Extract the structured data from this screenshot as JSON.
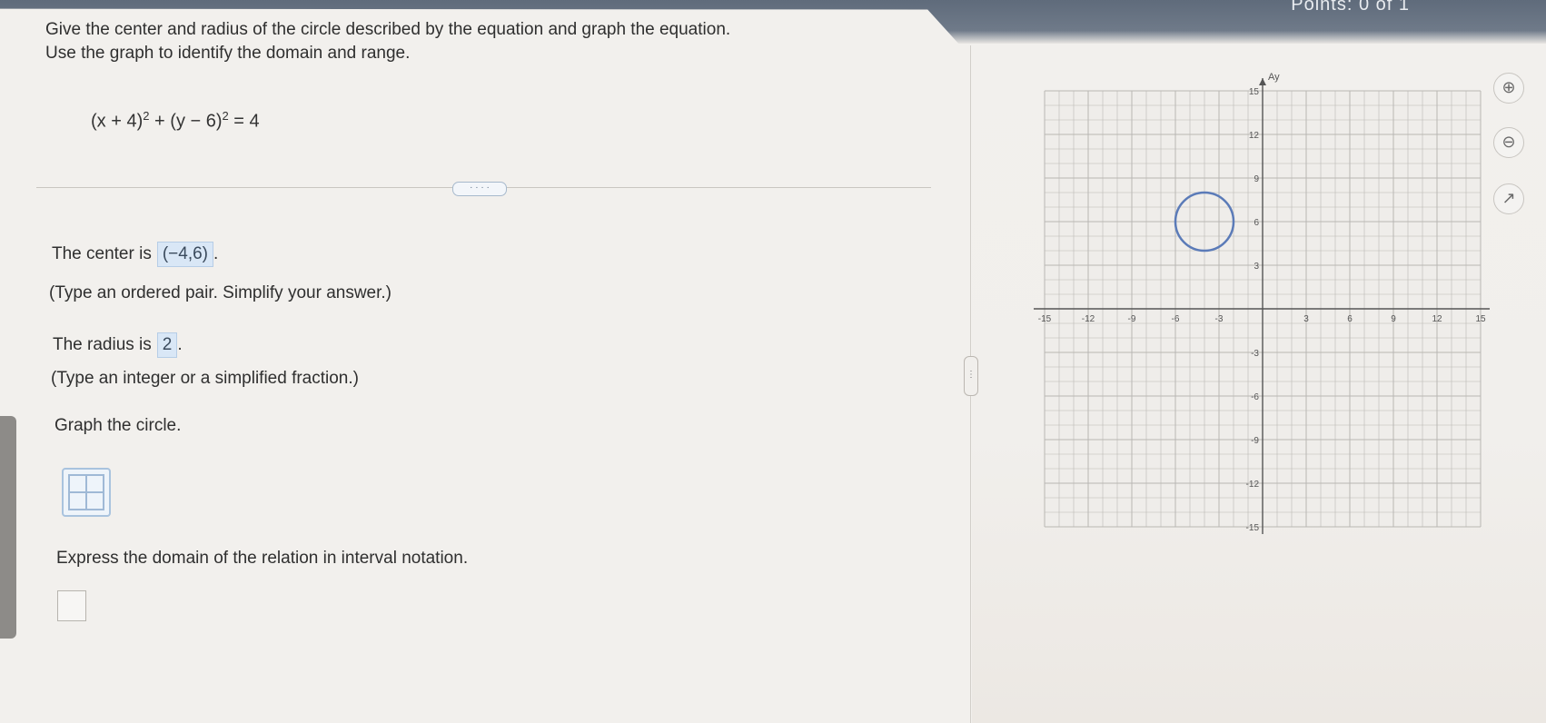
{
  "header": {
    "points": "Points: 0 of 1"
  },
  "question": {
    "line1": "Give the center and radius of the circle described by the equation and graph the equation.",
    "line2": "Use the graph to identify the domain and range.",
    "eq_part1": "(x + 4)",
    "eq_exp1": "2",
    "eq_part2": " + (y − 6)",
    "eq_exp2": "2",
    "eq_part3": " = 4"
  },
  "more_button": "· · · ·",
  "answers": {
    "center_label": "The center is",
    "center_value": "(−4,6)",
    "center_period": ".",
    "center_hint": "(Type an ordered pair. Simplify your answer.)",
    "radius_label": "The radius is",
    "radius_value": "2",
    "radius_period": ".",
    "radius_hint": "(Type an integer or a simplified fraction.)",
    "graph_prompt": "Graph the circle.",
    "domain_prompt": "Express the domain of the relation in interval notation."
  },
  "graph": {
    "y_axis_label": "Ay",
    "x_ticks": [
      "-15",
      "-12",
      "-9",
      "-6",
      "-3",
      "3",
      "6",
      "9",
      "12",
      "15"
    ],
    "y_ticks": [
      "15",
      "12",
      "9",
      "6",
      "3",
      "-3",
      "-6",
      "-9",
      "-12",
      "-15"
    ],
    "circle": {
      "center_x": -4,
      "center_y": 6,
      "radius": 2
    },
    "range": [
      -15,
      15
    ],
    "grid_color": "#b9b7b3",
    "axis_color": "#555555"
  },
  "tools": {
    "zoom_in": "⊕",
    "zoom_out": "⊖",
    "popout": "↗"
  },
  "splitter_icon": "⋮"
}
